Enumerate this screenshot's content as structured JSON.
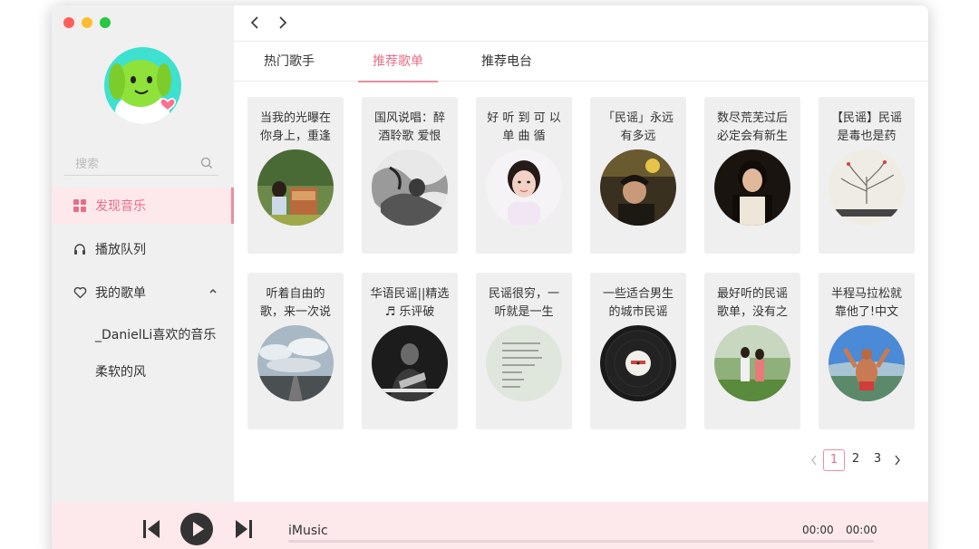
{
  "sidebar": {
    "search": {
      "placeholder": "搜索"
    },
    "nav": [
      {
        "label": "发现音乐",
        "icon": "grid-icon",
        "active": true
      },
      {
        "label": "播放队列",
        "icon": "headphones-icon"
      },
      {
        "label": "我的歌单",
        "icon": "heart-icon",
        "expanded": true
      }
    ],
    "playlists": [
      "_DanielLi喜欢的音乐",
      "柔软的风"
    ]
  },
  "tabs": [
    {
      "label": "热门歌手"
    },
    {
      "label": "推荐歌单",
      "active": true
    },
    {
      "label": "推荐电台"
    }
  ],
  "cards": [
    {
      "title": "当我的光曝在你身上，重逢"
    },
    {
      "title": "国风说唱：醉酒聆歌 爱恨"
    },
    {
      "title": "好 听 到 可 以 单 曲 循"
    },
    {
      "title": "「民谣」永远有多远"
    },
    {
      "title": "数尽荒芜过后必定会有新生"
    },
    {
      "title": "【民谣】民谣是毒也是药"
    },
    {
      "title": "听着自由的歌，来一次说"
    },
    {
      "title": "华语民谣||精选♬ 乐评破"
    },
    {
      "title": "民谣很穷，一听就是一生"
    },
    {
      "title": "一些适合男生的城市民谣"
    },
    {
      "title": "最好听的民谣歌单，没有之"
    },
    {
      "title": "半程马拉松就靠他了!中文"
    }
  ],
  "pagination": {
    "pages": [
      "1",
      "2",
      "3"
    ],
    "current": "1"
  },
  "player": {
    "track": "iMusic",
    "current_time": "00:00",
    "total_time": "00:00",
    "progress": 0
  },
  "colors": {
    "accent": "#e66f87",
    "accent_light": "#fde8ec",
    "sidebar_bg": "#f0f0f0",
    "card_bg": "#efefef"
  }
}
